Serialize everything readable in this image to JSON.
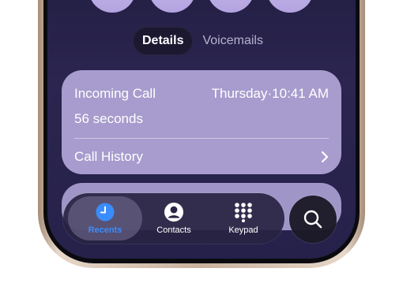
{
  "segments": {
    "details": "Details",
    "voicemails": "Voicemails"
  },
  "call": {
    "type": "Incoming Call",
    "duration": "56 seconds",
    "day": "Thursday",
    "separator": "·",
    "time": "10:41 AM",
    "history_label": "Call History"
  },
  "tabbar": {
    "recents": "Recents",
    "contacts": "Contacts",
    "keypad": "Keypad"
  },
  "colors": {
    "accent": "#3a8dff",
    "card": "#a79ccd",
    "background": "#201c3e"
  },
  "icons": {
    "recents": "clock-icon",
    "contacts": "person-icon",
    "keypad": "keypad-icon",
    "search": "search-icon",
    "history": "chevron-right-icon"
  }
}
